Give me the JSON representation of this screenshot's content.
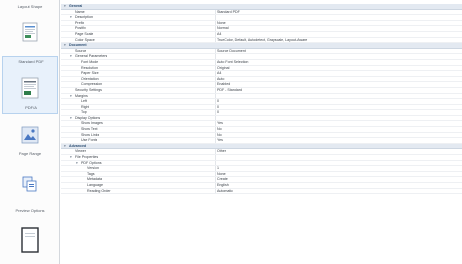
{
  "sidebar": {
    "items": [
      {
        "label": "Layout Shape",
        "icon": "layout-icon",
        "selected": false
      },
      {
        "label": "Standard PDF",
        "icon": "pdf-document-icon",
        "selected": true
      },
      {
        "label": "PDF/A",
        "icon": "pdfa-document-icon",
        "selected": false
      },
      {
        "label": "Page Range",
        "icon": "image-page-icon",
        "selected": false
      },
      {
        "label": "",
        "icon": "copy-pages-icon",
        "selected": false
      },
      {
        "label": "Preview Options",
        "icon": "preview-icon",
        "selected": false
      },
      {
        "label": "",
        "icon": "document-frame-icon",
        "selected": false
      }
    ]
  },
  "properties": {
    "rows": [
      {
        "type": "section",
        "name": "General",
        "value": "",
        "indent": 0
      },
      {
        "type": "prop",
        "name": "Name",
        "value": "Standard PDF",
        "indent": 1
      },
      {
        "type": "prop",
        "name": "Description",
        "value": "",
        "indent": 1
      },
      {
        "type": "prop",
        "name": "Prefix",
        "value": "None",
        "indent": 1
      },
      {
        "type": "prop",
        "name": "Postfix",
        "value": "Normal",
        "indent": 1
      },
      {
        "type": "prop",
        "name": "Page Scale",
        "value": "A4",
        "indent": 1
      },
      {
        "type": "prop",
        "name": "Color Space",
        "value": "TrueColor, Default, Autodetect, Grayscale, Layout-Aware",
        "indent": 1
      },
      {
        "type": "section",
        "name": "Document",
        "value": "",
        "indent": 0
      },
      {
        "type": "prop",
        "name": "Source",
        "value": "Source Document",
        "indent": 1
      },
      {
        "type": "prop",
        "name": "General Parameters",
        "value": "",
        "indent": 1
      },
      {
        "type": "prop",
        "name": "Font Mode",
        "value": "Auto Font Selection",
        "indent": 2
      },
      {
        "type": "prop",
        "name": "Resolution",
        "value": "Original",
        "indent": 2
      },
      {
        "type": "prop",
        "name": "Paper Size",
        "value": "A4",
        "indent": 2
      },
      {
        "type": "prop",
        "name": "Orientation",
        "value": "Auto",
        "indent": 2
      },
      {
        "type": "prop",
        "name": "Compression",
        "value": "Enabled",
        "indent": 2
      },
      {
        "type": "prop",
        "name": "Security Settings",
        "value": "PDF - Standard",
        "indent": 1
      },
      {
        "type": "prop",
        "name": "Margins",
        "value": "",
        "indent": 1
      },
      {
        "type": "prop",
        "name": "Left",
        "value": "0",
        "indent": 2
      },
      {
        "type": "prop",
        "name": "Right",
        "value": "0",
        "indent": 2
      },
      {
        "type": "prop",
        "name": "Top",
        "value": "0",
        "indent": 2
      },
      {
        "type": "prop",
        "name": "Display Options",
        "value": "",
        "indent": 1
      },
      {
        "type": "prop",
        "name": "Show Images",
        "value": "Yes",
        "indent": 2
      },
      {
        "type": "prop",
        "name": "Show Text",
        "value": "No",
        "indent": 2
      },
      {
        "type": "prop",
        "name": "Show Links",
        "value": "No",
        "indent": 2
      },
      {
        "type": "prop",
        "name": "Use Fonts",
        "value": "Yes",
        "indent": 2
      },
      {
        "type": "section",
        "name": "Advanced",
        "value": "",
        "indent": 0
      },
      {
        "type": "prop",
        "name": "Viewer",
        "value": "Other",
        "indent": 1
      },
      {
        "type": "prop",
        "name": "File Properties",
        "value": "",
        "indent": 1
      },
      {
        "type": "prop",
        "name": "PDF Options",
        "value": "",
        "indent": 2
      },
      {
        "type": "prop",
        "name": "Version",
        "value": "1",
        "indent": 3
      },
      {
        "type": "prop",
        "name": "Tags",
        "value": "None",
        "indent": 3
      },
      {
        "type": "prop",
        "name": "Metadata",
        "value": "Create",
        "indent": 3
      },
      {
        "type": "prop",
        "name": "Language",
        "value": "English",
        "indent": 3
      },
      {
        "type": "prop",
        "name": "Reading Order",
        "value": "Automatic",
        "indent": 3
      }
    ]
  },
  "colors": {
    "section_header_bg": "#e3e9f1",
    "selection_bg": "#e8f1fb",
    "accent_blue": "#4a78c2"
  }
}
